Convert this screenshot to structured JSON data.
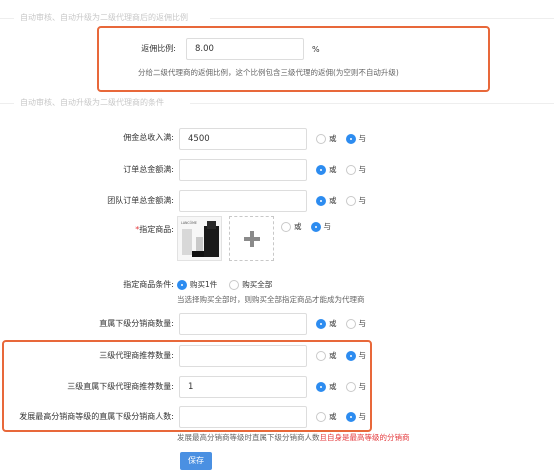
{
  "section_auto_rebate": {
    "title": "自动审核、自动升级为二级代理商后的返佣比例"
  },
  "rebate": {
    "label": "返佣比例:",
    "value": "8.00",
    "unit": "%",
    "help": "分给二级代理商的返佣比例，这个比例包含三级代理的返佣(为空则不自动升级)"
  },
  "section_conditions": {
    "title": "自动审核、自动升级为二级代理商的条件"
  },
  "conditions": {
    "commission": {
      "label": "佣金总收入满:",
      "value": "4500",
      "or": "或",
      "and": "与",
      "selected": "and"
    },
    "order_total": {
      "label": "订单总金额满:",
      "value": "",
      "or": "或",
      "and": "与",
      "selected": "or"
    },
    "team_order_total": {
      "label": "团队订单总金额满:",
      "value": "",
      "or": "或",
      "and": "与",
      "selected": "or"
    },
    "products": {
      "required_mark": "*",
      "label": "指定商品:",
      "thumb_brand": "LANCÔME",
      "or": "或",
      "and": "与",
      "selected": "and"
    },
    "product_condition": {
      "label": "指定商品条件:",
      "buy_one": "购买1件",
      "buy_all": "购买全部",
      "selected": "buy_one",
      "help": "当选择购买全部时，则购买全部指定商品才能成为代理商"
    },
    "direct_sub_count": {
      "label": "直属下级分销商数量:",
      "value": "",
      "or": "或",
      "and": "与",
      "selected": "or"
    },
    "level3_count": {
      "label": "三级代理商推荐数量:",
      "value": "",
      "or": "或",
      "and": "与",
      "selected": "and"
    },
    "level3_direct_count": {
      "label": "三级直属下级代理商推荐数量:",
      "value": "1",
      "or": "或",
      "and": "与",
      "selected": "or"
    },
    "top_level_direct_count": {
      "label": "发展最高分销商等级的直属下级分销商人数:",
      "value": "",
      "or": "或",
      "and": "与",
      "selected": "and",
      "help_prefix": "发展最高分销商等级时直属下级分销商人数",
      "help_highlight": "且自身是最高等级的分销商"
    }
  },
  "save_label": "保存",
  "colors": {
    "accent": "#2d8cf0",
    "button": "#4a90e2",
    "highlight": "#e8683a",
    "warning_text": "#e4393c"
  }
}
